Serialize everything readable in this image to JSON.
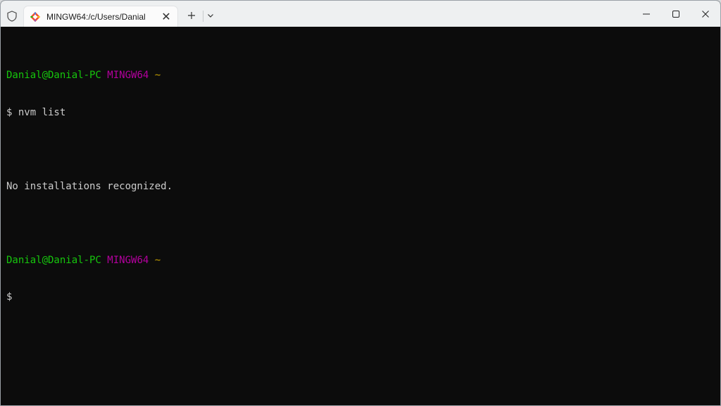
{
  "window": {
    "tab_title": "MINGW64:/c/Users/Danial",
    "tab_close_glyph": "✕",
    "controls": [
      "minimize",
      "maximize",
      "close"
    ]
  },
  "terminal": {
    "prompt_user_host": "Danial@Danial-PC",
    "prompt_env": "MINGW64",
    "prompt_dir": "~",
    "command_1": "$ nvm list",
    "output_1": "No installations recognized.",
    "prompt_2_user_host": "Danial@Danial-PC",
    "prompt_2_env": "MINGW64",
    "prompt_2_dir": "~",
    "prompt_2_symbol": "$"
  },
  "colors": {
    "user_host": "#16c60c",
    "env": "#b4009e",
    "dir": "#c19c00",
    "text": "#cccccc",
    "background": "#0c0c0c",
    "titlebar": "#eef0f1"
  },
  "icons": {
    "titlebar": [
      "shield-icon",
      "git-bash-icon",
      "close-icon",
      "plus-icon",
      "chevron-down-icon"
    ],
    "window": [
      "minimize-icon",
      "maximize-icon",
      "close-window-icon"
    ]
  }
}
